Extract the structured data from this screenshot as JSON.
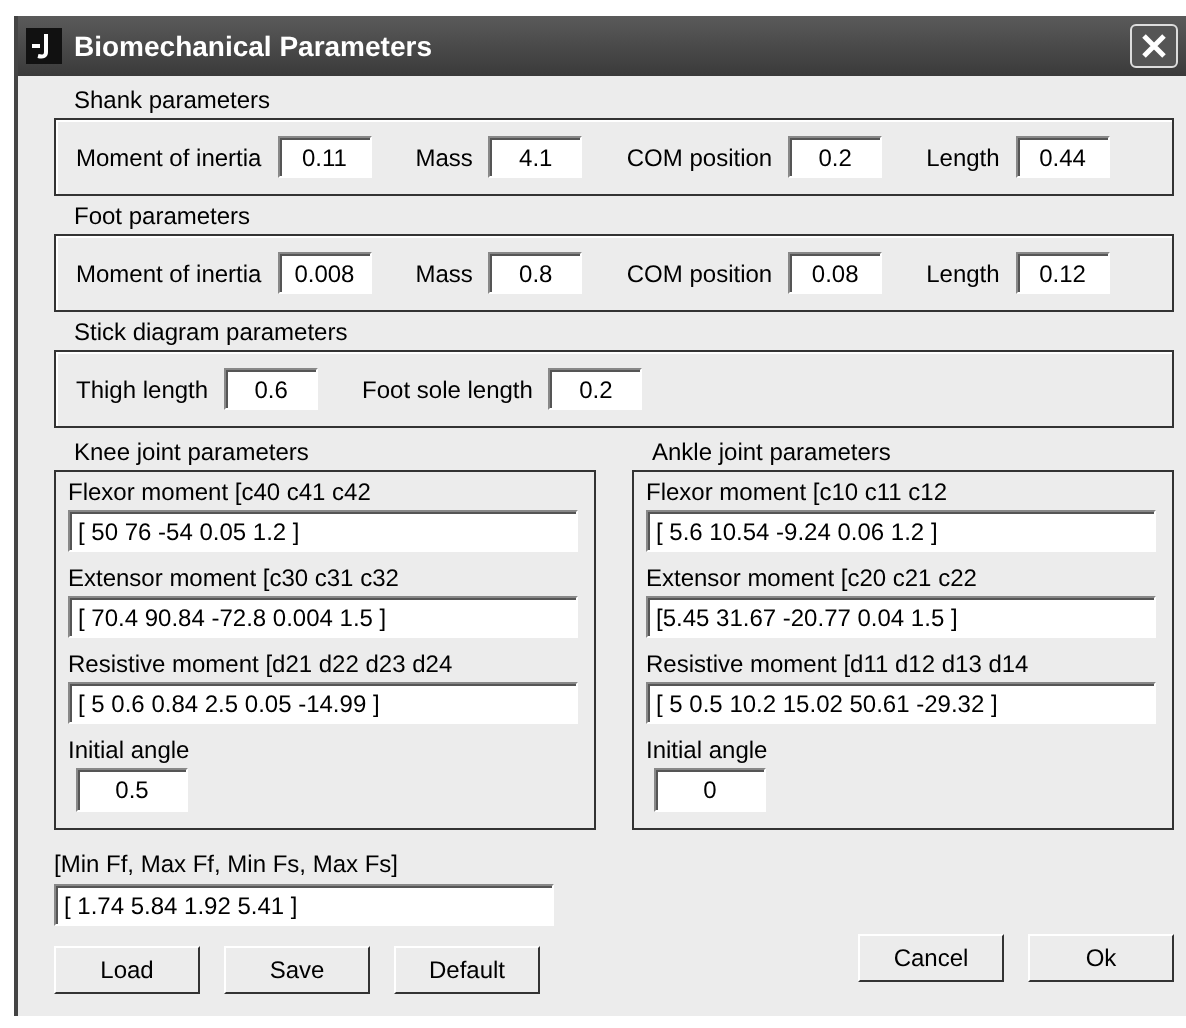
{
  "window": {
    "title": "Biomechanical Parameters"
  },
  "groups": [
    {
      "title": "Shank parameters",
      "fields": [
        {
          "label": "Moment of inertia",
          "value": "0.11"
        },
        {
          "label": "Mass",
          "value": "4.1"
        },
        {
          "label": "COM position",
          "value": "0.2"
        },
        {
          "label": "Length",
          "value": "0.44"
        }
      ]
    },
    {
      "title": "Foot parameters",
      "fields": [
        {
          "label": "Moment of inertia",
          "value": "0.008"
        },
        {
          "label": "Mass",
          "value": "0.8"
        },
        {
          "label": "COM position",
          "value": "0.08"
        },
        {
          "label": "Length",
          "value": "0.12"
        }
      ]
    },
    {
      "title": "Stick diagram parameters",
      "fields": [
        {
          "label": "Thigh length",
          "value": "0.6"
        },
        {
          "label": "Foot sole length",
          "value": "0.2"
        }
      ]
    }
  ],
  "joints": [
    {
      "title": "Knee joint parameters",
      "moments": [
        {
          "label": "Flexor moment [c40 c41 c42",
          "value": "[ 50 76 -54 0.05 1.2 ]"
        },
        {
          "label": "Extensor moment [c30 c31 c32",
          "value": "[ 70.4 90.84 -72.8 0.004 1.5 ]"
        },
        {
          "label": "Resistive moment [d21 d22 d23 d24",
          "value": "[ 5 0.6 0.84 2.5 0.05 -14.99 ]"
        }
      ],
      "initial_angle": {
        "label": "Initial angle",
        "value": "0.5"
      }
    },
    {
      "title": "Ankle joint parameters",
      "moments": [
        {
          "label": "Flexor moment [c10 c11 c12",
          "value": "[ 5.6 10.54 -9.24 0.06 1.2 ]"
        },
        {
          "label": "Extensor moment [c20 c21 c22",
          "value": "[5.45 31.67 -20.77 0.04 1.5 ]"
        },
        {
          "label": "Resistive moment [d11 d12 d13 d14",
          "value": "[ 5 0.5 10.2 15.02 50.61 -29.32 ]"
        }
      ],
      "initial_angle": {
        "label": "Initial angle",
        "value": "0"
      }
    }
  ],
  "limits": {
    "label": "[Min Ff, Max Ff, Min Fs, Max Fs]",
    "value": "[ 1.74 5.84 1.92 5.41 ]"
  },
  "buttons_left": [
    "Load",
    "Save",
    "Default"
  ],
  "buttons_right": [
    "Cancel",
    "Ok"
  ]
}
